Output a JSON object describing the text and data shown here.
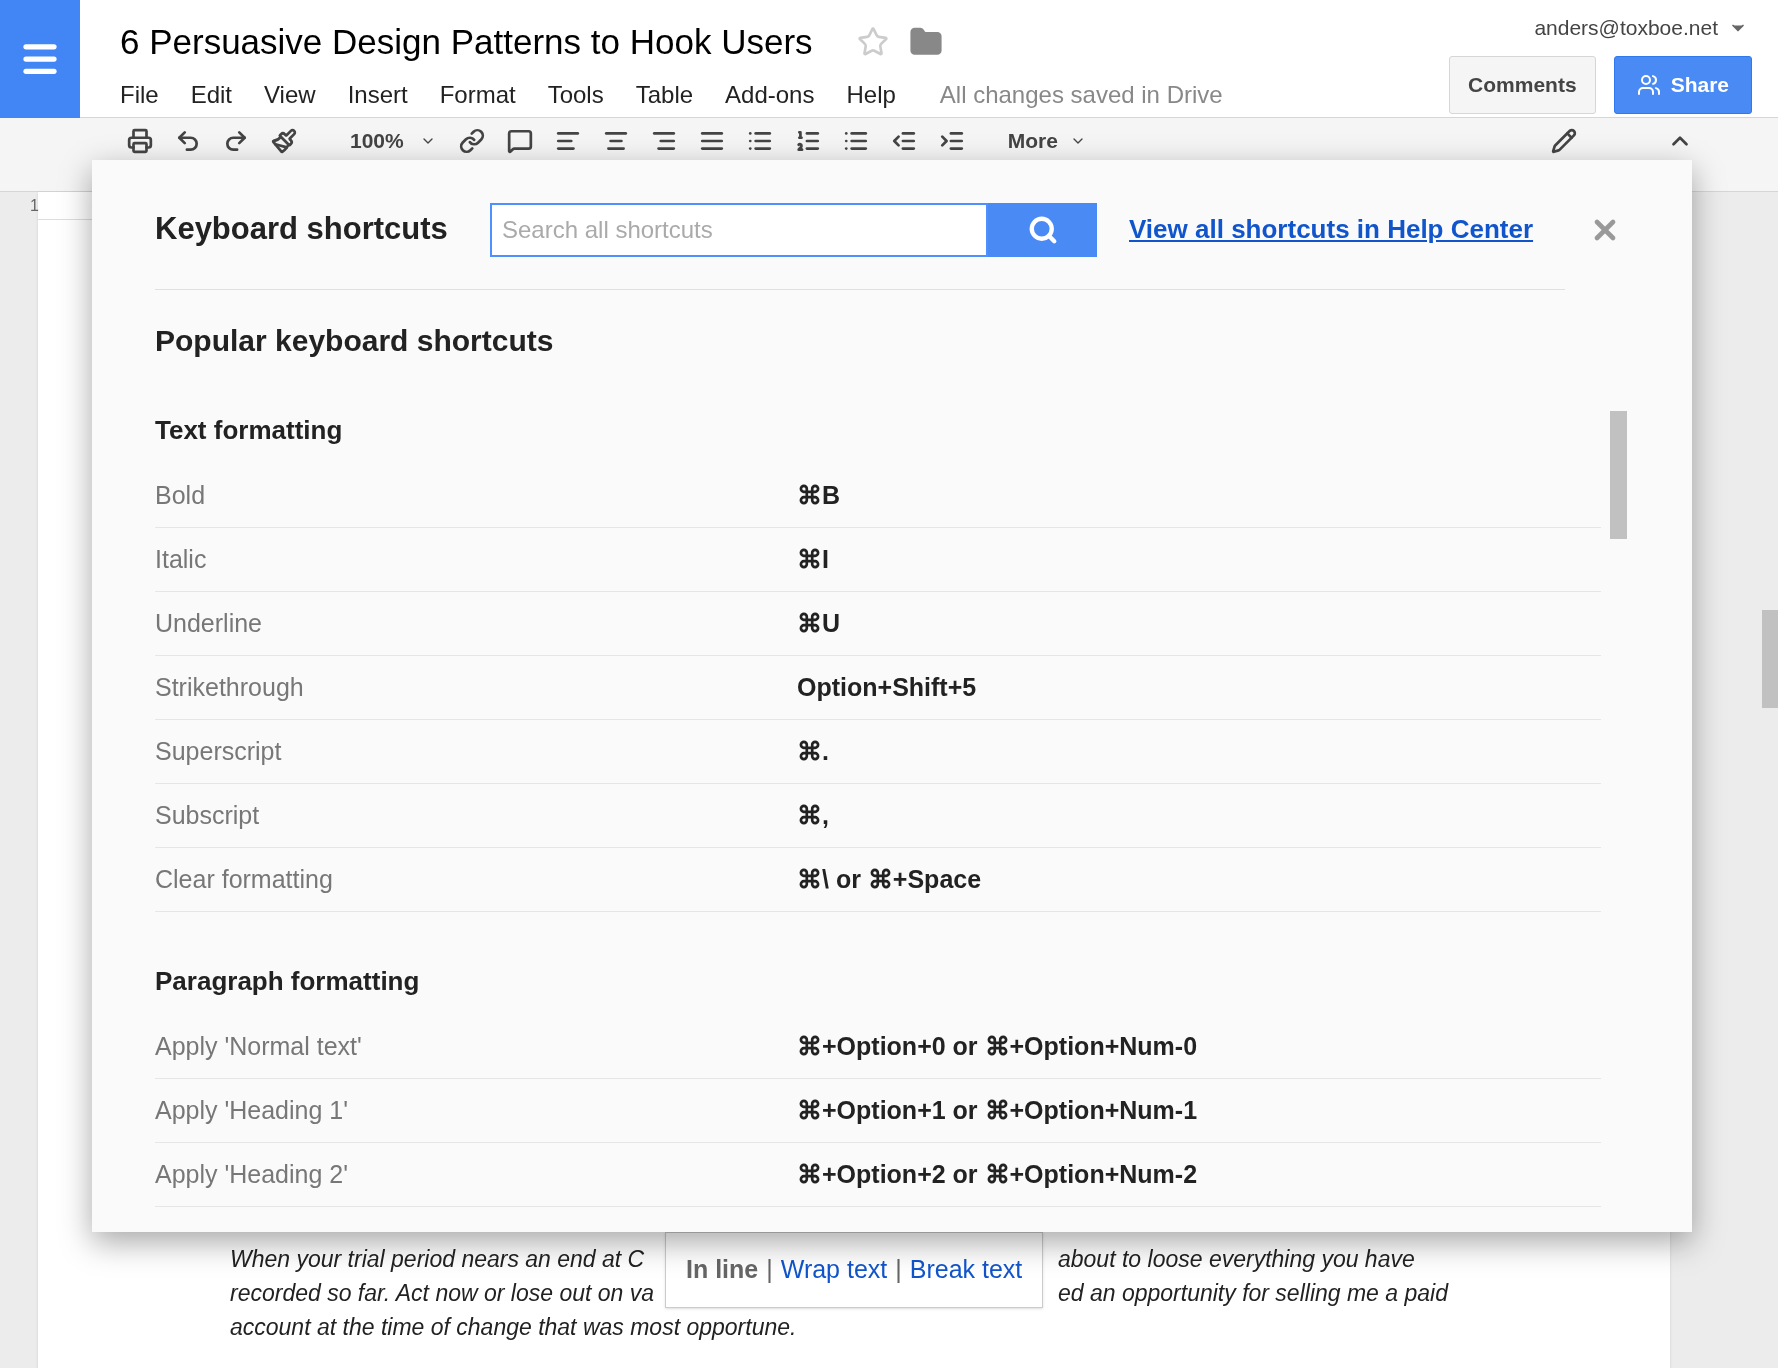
{
  "document": {
    "title": "6 Persuasive Design Patterns to Hook Users",
    "starred": false,
    "menu": [
      "File",
      "Edit",
      "View",
      "Insert",
      "Format",
      "Tools",
      "Table",
      "Add-ons",
      "Help"
    ],
    "save_status": "All changes saved in Drive",
    "account": "anders@toxboe.net",
    "comments_button": "Comments",
    "share_button": "Share",
    "zoom": "100%",
    "more": "More",
    "ruler_mark": "1",
    "text_lines": [
      [
        "When your trial period nears an end at C",
        "about to loose everything you have"
      ],
      [
        "recorded so far. Act now or lose out on va",
        "ed an opportunity for selling me a paid"
      ],
      [
        "account at the time of change that was most opportune."
      ]
    ],
    "image_option_separator": "|",
    "image_options": [
      {
        "label": "In line",
        "selected": true
      },
      {
        "label": "Wrap text",
        "selected": false
      },
      {
        "label": "Break text",
        "selected": false
      }
    ]
  },
  "dialog": {
    "title": "Keyboard shortcuts",
    "search": {
      "placeholder": "Search all shortcuts"
    },
    "help_link": "View all shortcuts in Help Center",
    "heading": "Popular keyboard shortcuts",
    "groups": [
      {
        "title": "Text formatting",
        "shortcuts": [
          {
            "action": "Bold",
            "keys": "⌘B"
          },
          {
            "action": "Italic",
            "keys": "⌘I"
          },
          {
            "action": "Underline",
            "keys": "⌘U"
          },
          {
            "action": "Strikethrough",
            "keys": "Option+Shift+5"
          },
          {
            "action": "Superscript",
            "keys": "⌘."
          },
          {
            "action": "Subscript",
            "keys": "⌘,"
          },
          {
            "action": "Clear formatting",
            "keys": "⌘\\ or ⌘+Space"
          }
        ]
      },
      {
        "title": "Paragraph formatting",
        "shortcuts": [
          {
            "action": "Apply 'Normal text'",
            "keys": "⌘+Option+0 or ⌘+Option+Num-0"
          },
          {
            "action": "Apply 'Heading 1'",
            "keys": "⌘+Option+1 or ⌘+Option+Num-1"
          },
          {
            "action": "Apply 'Heading 2'",
            "keys": "⌘+Option+2 or ⌘+Option+Num-2"
          }
        ]
      }
    ]
  }
}
